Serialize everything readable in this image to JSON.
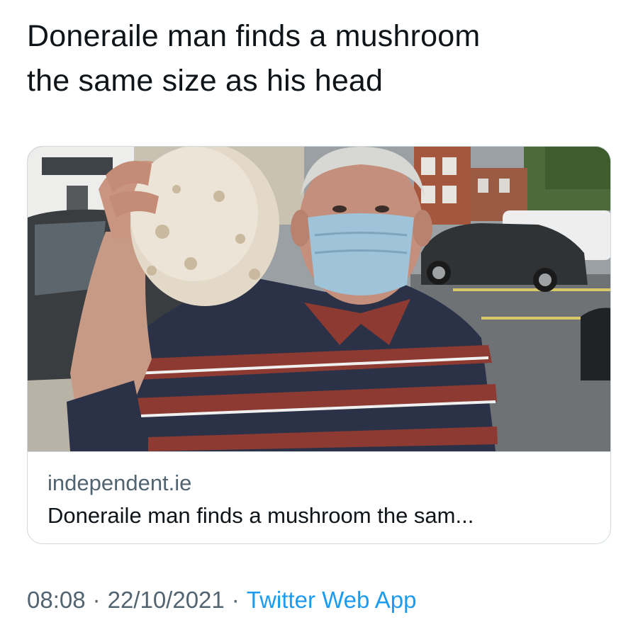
{
  "tweet": {
    "text_line1": "Doneraile man finds a mushroom",
    "text_line2": "the same size as his head"
  },
  "card": {
    "domain": "independent.ie",
    "title": "Doneraile man finds a mushroom the sam...",
    "image_description_icon": "photo-man-holding-giant-mushroom"
  },
  "meta": {
    "time": "08:08",
    "separator": "·",
    "date": "22/10/2021",
    "source": "Twitter Web App"
  },
  "colors": {
    "text_primary": "#0f1419",
    "text_secondary": "#536471",
    "link": "#1d9bf0",
    "border": "#cfd9de"
  }
}
